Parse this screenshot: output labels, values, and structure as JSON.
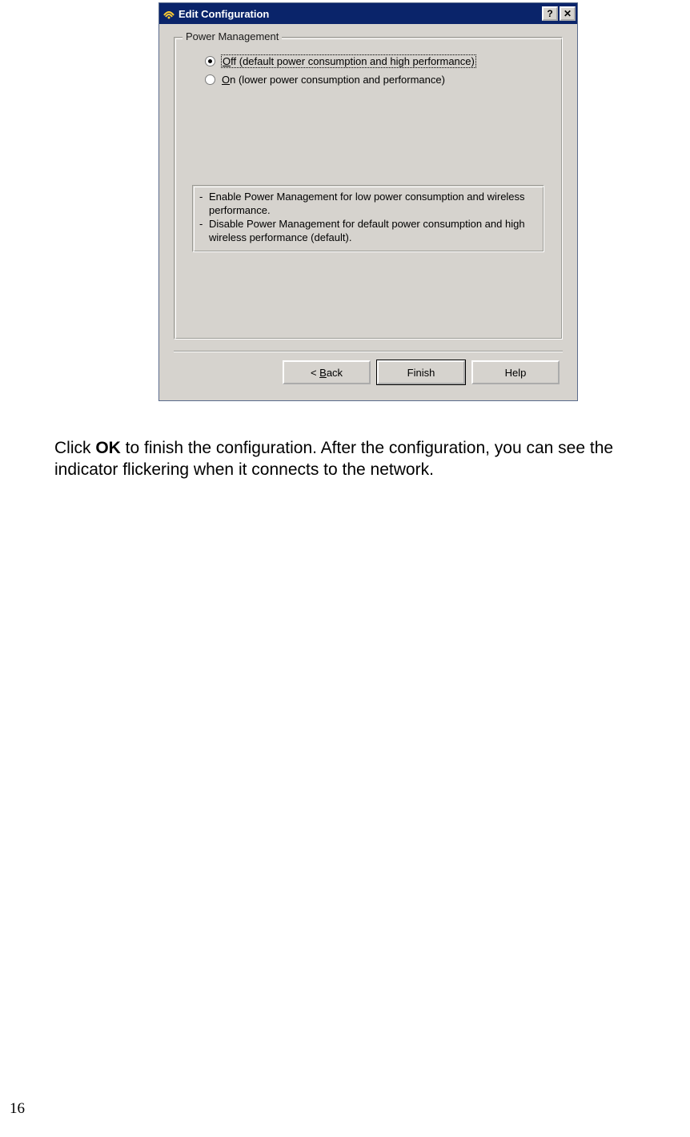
{
  "dialog": {
    "title": "Edit Configuration",
    "titleButtons": {
      "help": "?",
      "close": "✕"
    },
    "group": {
      "title": "Power Management",
      "options": [
        {
          "mnemonic": "O",
          "rest": "ff",
          "extra": "   (default power consumption and high performance)",
          "checked": true
        },
        {
          "mnemonic": "O",
          "rest": "n",
          "extra": "   (lower power consumption and performance)",
          "checked": false
        }
      ],
      "desc": [
        "Enable Power Management for low power consumption and wireless performance.",
        "Disable Power Management for default power consumption and high wireless performance (default)."
      ]
    },
    "buttons": {
      "back_pre": "< ",
      "back_mn": "B",
      "back_post": "ack",
      "finish": "Finish",
      "help": "Help"
    }
  },
  "instruction": {
    "pre": "Click ",
    "bold": "OK",
    "post": " to finish the configuration. After the configuration, you can see the indicator flickering when it connects to the network."
  },
  "pageNumber": "16"
}
